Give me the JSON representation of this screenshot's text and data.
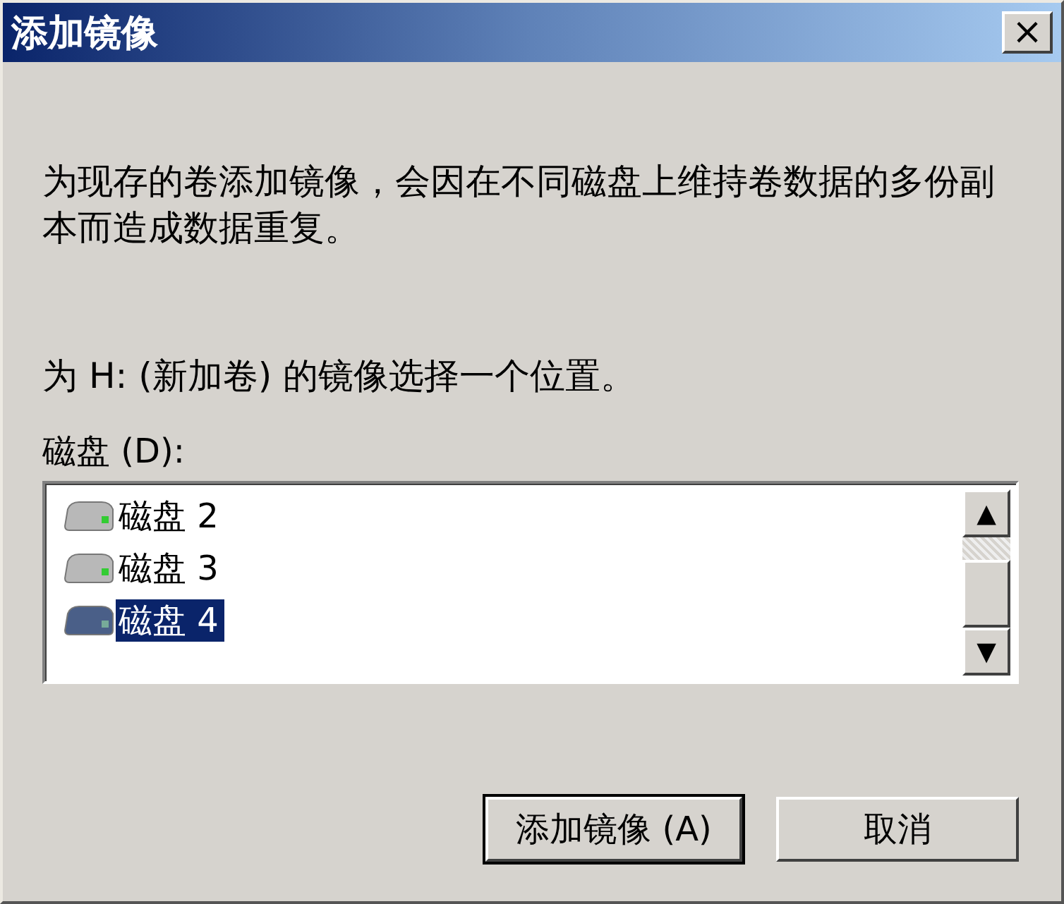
{
  "window": {
    "title": "添加镜像",
    "close": "×"
  },
  "description": "为现存的卷添加镜像，会因在不同磁盘上维持卷数据的多份副本而造成数据重复。",
  "prompt": "为 H: (新加卷) 的镜像选择一个位置。",
  "disks_label": "磁盘 (D):",
  "disks": [
    {
      "label": "磁盘 2",
      "selected": false
    },
    {
      "label": "磁盘 3",
      "selected": false
    },
    {
      "label": "磁盘 4",
      "selected": true
    }
  ],
  "scroll_up": "▲",
  "scroll_down": "▼",
  "buttons": [
    {
      "label": "添加镜像 (A)",
      "default": true
    },
    {
      "label": "取消",
      "default": false
    }
  ]
}
